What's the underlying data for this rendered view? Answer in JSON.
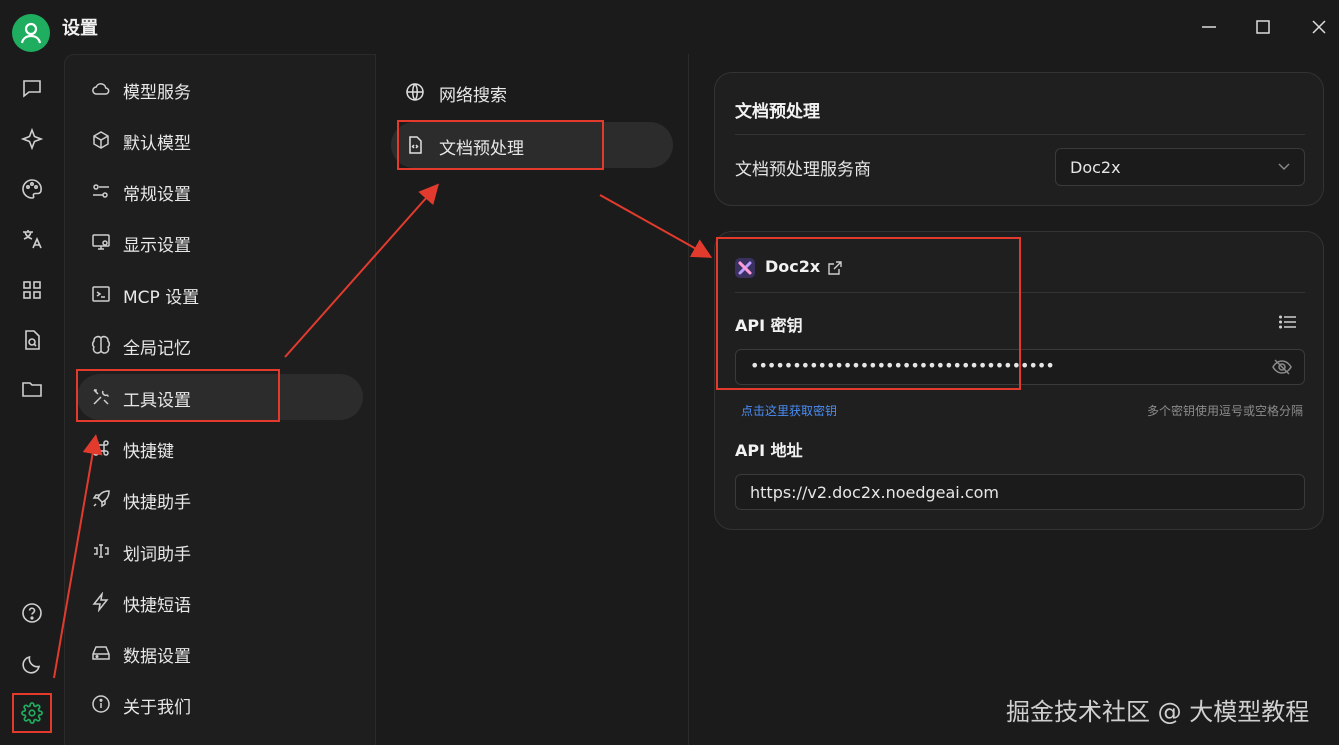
{
  "window": {
    "title": "设置"
  },
  "colors": {
    "accent": "#1fae5f",
    "annotation": "#e23b2e",
    "link": "#4a8df6"
  },
  "rail": {
    "icons": [
      "chat-icon",
      "sparkle-icon",
      "palette-icon",
      "translate-icon",
      "apps-icon",
      "doc-search-icon",
      "folder-icon",
      "help-icon",
      "moon-icon",
      "settings-gear-icon"
    ]
  },
  "settings_nav": {
    "items": [
      {
        "label": "模型服务",
        "icon": "cloud-icon"
      },
      {
        "label": "默认模型",
        "icon": "cube-icon"
      },
      {
        "label": "常规设置",
        "icon": "sliders-icon"
      },
      {
        "label": "显示设置",
        "icon": "monitor-gear-icon"
      },
      {
        "label": "MCP 设置",
        "icon": "terminal-icon"
      },
      {
        "label": "全局记忆",
        "icon": "brain-icon"
      },
      {
        "label": "工具设置",
        "icon": "tools-icon",
        "active": true
      },
      {
        "label": "快捷键",
        "icon": "command-icon"
      },
      {
        "label": "快捷助手",
        "icon": "rocket-icon"
      },
      {
        "label": "划词助手",
        "icon": "text-select-icon"
      },
      {
        "label": "快捷短语",
        "icon": "zap-icon"
      },
      {
        "label": "数据设置",
        "icon": "hard-drive-icon"
      },
      {
        "label": "关于我们",
        "icon": "info-icon"
      }
    ]
  },
  "tool_nav": {
    "items": [
      {
        "label": "网络搜索",
        "icon": "globe-icon"
      },
      {
        "label": "文档预处理",
        "icon": "file-code-icon",
        "active": true
      }
    ]
  },
  "preprocess": {
    "title": "文档预处理",
    "provider_label": "文档预处理服务商",
    "provider_value": "Doc2x"
  },
  "provider": {
    "name": "Doc2x",
    "api_key_label": "API 密钥",
    "api_key_value": "••••••••••••••••••••••••••••••••••••",
    "get_key_link": "点击这里获取密钥",
    "key_hint": "多个密钥使用逗号或空格分隔",
    "api_url_label": "API 地址",
    "api_url_value": "https://v2.doc2x.noedgeai.com"
  },
  "watermark": "掘金技术社区 @ 大模型教程"
}
